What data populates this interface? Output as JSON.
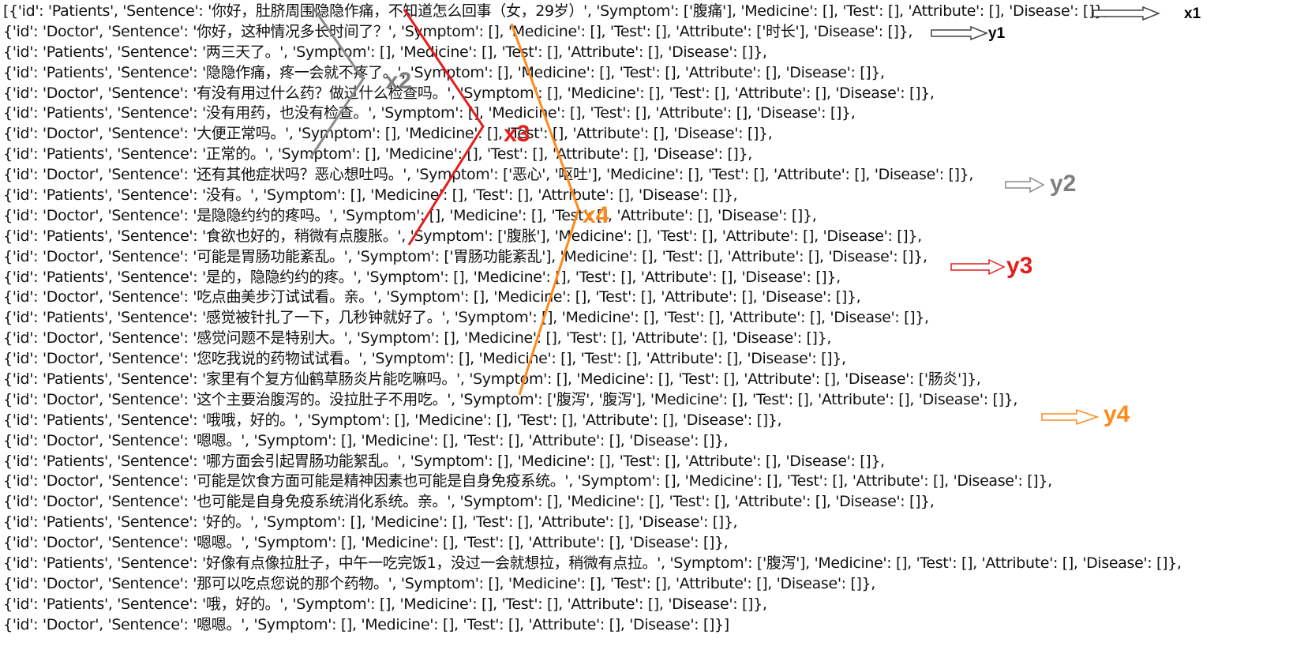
{
  "dialogue": {
    "lines": [
      "[{'id': 'Patients', 'Sentence': '你好，肚脐周围隐隐作痛，不知道怎么回事（女，29岁）', 'Symptom': ['腹痛'], 'Medicine': [], 'Test': [], 'Attribute': [], 'Disease': []},",
      "{'id': 'Doctor', 'Sentence': '你好，这种情况多长时间了？', 'Symptom': [], 'Medicine': [], 'Test': [], 'Attribute': ['时长'], 'Disease': []},",
      "{'id': 'Patients', 'Sentence': '两三天了。', 'Symptom': [], 'Medicine': [], 'Test': [], 'Attribute': [], 'Disease': []},",
      "{'id': 'Patients', 'Sentence': '隐隐作痛，疼一会就不疼了。', 'Symptom': [], 'Medicine': [], 'Test': [], 'Attribute': [], 'Disease': []},",
      "{'id': 'Doctor', 'Sentence': '有没有用过什么药？做过什么检查吗。', 'Symptom': [], 'Medicine': [], 'Test': [], 'Attribute': [], 'Disease': []},",
      "{'id': 'Patients', 'Sentence': '没有用药，也没有检查。', 'Symptom': [], 'Medicine': [], 'Test': [], 'Attribute': [], 'Disease': []},",
      "{'id': 'Doctor', 'Sentence': '大便正常吗。', 'Symptom': [], 'Medicine': [], 'Test': [], 'Attribute': [], 'Disease': []},",
      "{'id': 'Patients', 'Sentence': '正常的。', 'Symptom': [], 'Medicine': [], 'Test': [], 'Attribute': [], 'Disease': []},",
      "{'id': 'Doctor', 'Sentence': '还有其他症状吗？恶心想吐吗。', 'Symptom': ['恶心', '呕吐'], 'Medicine': [], 'Test': [], 'Attribute': [], 'Disease': []},",
      "{'id': 'Patients', 'Sentence': '没有。', 'Symptom': [], 'Medicine': [], 'Test': [], 'Attribute': [], 'Disease': []},",
      "{'id': 'Doctor', 'Sentence': '是隐隐约约的疼吗。', 'Symptom': [], 'Medicine': [], 'Test': [], 'Attribute': [], 'Disease': []},",
      "{'id': 'Patients', 'Sentence': '食欲也好的，稍微有点腹胀。', 'Symptom': ['腹胀'], 'Medicine': [], 'Test': [], 'Attribute': [], 'Disease': []},",
      "{'id': 'Doctor', 'Sentence': '可能是胃肠功能紊乱。', 'Symptom': ['胃肠功能紊乱'], 'Medicine': [], 'Test': [], 'Attribute': [], 'Disease': []},",
      "{'id': 'Patients', 'Sentence': '是的，隐隐约约的疼。', 'Symptom': [], 'Medicine': [], 'Test': [], 'Attribute': [], 'Disease': []},",
      "{'id': 'Doctor', 'Sentence': '吃点曲美步汀试试看。亲。', 'Symptom': [], 'Medicine': [], 'Test': [], 'Attribute': [], 'Disease': []},",
      "{'id': 'Patients', 'Sentence': '感觉被针扎了一下，几秒钟就好了。', 'Symptom': [], 'Medicine': [], 'Test': [], 'Attribute': [], 'Disease': []},",
      "{'id': 'Doctor', 'Sentence': '感觉问题不是特别大。', 'Symptom': [], 'Medicine': [], 'Test': [], 'Attribute': [], 'Disease': []},",
      "{'id': 'Doctor', 'Sentence': '您吃我说的药物试试看。', 'Symptom': [], 'Medicine': [], 'Test': [], 'Attribute': [], 'Disease': []},",
      "{'id': 'Patients', 'Sentence': '家里有个复方仙鹤草肠炎片能吃嘛吗。', 'Symptom': [], 'Medicine': [], 'Test': [], 'Attribute': [], 'Disease': ['肠炎']},",
      "{'id': 'Doctor', 'Sentence': '这个主要治腹泻的。没拉肚子不用吃。', 'Symptom': ['腹泻', '腹泻'], 'Medicine': [], 'Test': [], 'Attribute': [], 'Disease': []},",
      "{'id': 'Patients', 'Sentence': '哦哦，好的。', 'Symptom': [], 'Medicine': [], 'Test': [], 'Attribute': [], 'Disease': []},",
      "{'id': 'Doctor', 'Sentence': '嗯嗯。', 'Symptom': [], 'Medicine': [], 'Test': [], 'Attribute': [], 'Disease': []},",
      "{'id': 'Patients', 'Sentence': '哪方面会引起胃肠功能絮乱。', 'Symptom': [], 'Medicine': [], 'Test': [], 'Attribute': [], 'Disease': []},",
      "{'id': 'Doctor', 'Sentence': '可能是饮食方面可能是精神因素也可能是自身免疫系统。', 'Symptom': [], 'Medicine': [], 'Test': [], 'Attribute': [], 'Disease': []},",
      "{'id': 'Doctor', 'Sentence': '也可能是自身免疫系统消化系统。亲。', 'Symptom': [], 'Medicine': [], 'Test': [], 'Attribute': [], 'Disease': []},",
      "{'id': 'Patients', 'Sentence': '好的。', 'Symptom': [], 'Medicine': [], 'Test': [], 'Attribute': [], 'Disease': []},",
      "{'id': 'Doctor', 'Sentence': '嗯嗯。', 'Symptom': [], 'Medicine': [], 'Test': [], 'Attribute': [], 'Disease': []},",
      "{'id': 'Patients', 'Sentence': '好像有点像拉肚子，中午一吃完饭1，没过一会就想拉，稍微有点拉。', 'Symptom': ['腹泻'], 'Medicine': [], 'Test': [], 'Attribute': [], 'Disease': []},",
      "{'id': 'Doctor', 'Sentence': '那可以吃点您说的那个药物。', 'Symptom': [], 'Medicine': [], 'Test': [], 'Attribute': [], 'Disease': []},",
      "{'id': 'Patients', 'Sentence': '哦，好的。', 'Symptom': [], 'Medicine': [], 'Test': [], 'Attribute': [], 'Disease': []},",
      "{'id': 'Doctor', 'Sentence': '嗯嗯。', 'Symptom': [], 'Medicine': [], 'Test': [], 'Attribute': [], 'Disease': []}]"
    ]
  },
  "annotations": {
    "x1": "x1",
    "y1": "y1",
    "x2": "x2",
    "y2": "y2",
    "x3": "x3",
    "y3": "y3",
    "x4": "x4",
    "y4": "y4"
  },
  "colors": {
    "text": "#111111",
    "gray": "#7f7f7f",
    "red": "#e41d1d",
    "orange": "#ff8a1c",
    "black": "#000000"
  }
}
